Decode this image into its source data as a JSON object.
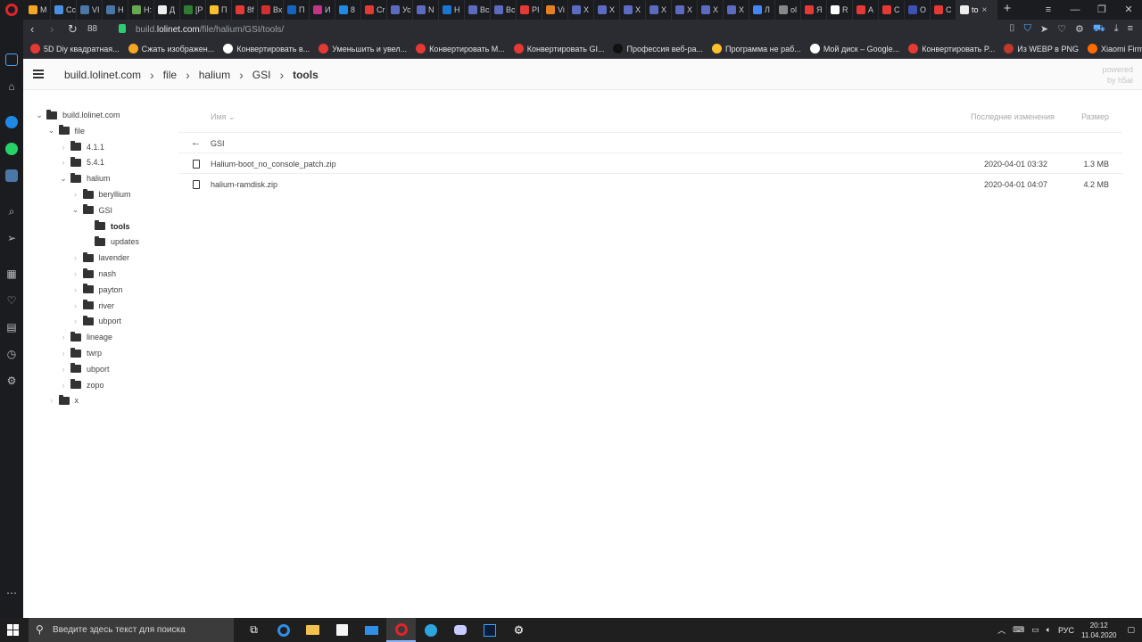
{
  "browser": {
    "tabs": [
      {
        "label": "M",
        "color": "#f5a623"
      },
      {
        "label": "Cc",
        "color": "#4a90e2"
      },
      {
        "label": "VI",
        "color": "#4a76a8"
      },
      {
        "label": "H",
        "color": "#4a76a8"
      },
      {
        "label": "H:",
        "color": "#6aa84f"
      },
      {
        "label": "Д",
        "color": "#eeeeee"
      },
      {
        "label": "[P",
        "color": "#2e7d32"
      },
      {
        "label": "П",
        "color": "#fbc02d"
      },
      {
        "label": "8f",
        "color": "#e53935"
      },
      {
        "label": "Вх",
        "color": "#d32f2f"
      },
      {
        "label": "П",
        "color": "#1565c0"
      },
      {
        "label": "И",
        "color": "#c13584"
      },
      {
        "label": "8",
        "color": "#1e88e5"
      },
      {
        "label": "Cr",
        "color": "#e53935"
      },
      {
        "label": "Ус",
        "color": "#5c6bc0"
      },
      {
        "label": "N",
        "color": "#5c6bc0"
      },
      {
        "label": "Н",
        "color": "#1976d2"
      },
      {
        "label": "Вс",
        "color": "#5c6bc0"
      },
      {
        "label": "Вс",
        "color": "#5c6bc0"
      },
      {
        "label": "PI",
        "color": "#e53935"
      },
      {
        "label": "Vi",
        "color": "#e67e22"
      },
      {
        "label": "X",
        "color": "#5c6bc0"
      },
      {
        "label": "X",
        "color": "#5c6bc0"
      },
      {
        "label": "X",
        "color": "#5c6bc0"
      },
      {
        "label": "X",
        "color": "#5c6bc0"
      },
      {
        "label": "X",
        "color": "#5c6bc0"
      },
      {
        "label": "X",
        "color": "#5c6bc0"
      },
      {
        "label": "X",
        "color": "#5c6bc0"
      },
      {
        "label": "Л",
        "color": "#4285f4"
      },
      {
        "label": "ol",
        "color": "#888888"
      },
      {
        "label": "Я",
        "color": "#e53935"
      },
      {
        "label": "R",
        "color": "#ffffff"
      },
      {
        "label": "A",
        "color": "#e53935"
      },
      {
        "label": "C",
        "color": "#e53935"
      },
      {
        "label": "O",
        "color": "#3f51b5"
      },
      {
        "label": "C",
        "color": "#e53935"
      }
    ],
    "active_tab": {
      "label": "to",
      "close": "×"
    },
    "new_tab": "+",
    "zoom": "88",
    "url_prefix": "build.",
    "url_domain": "lolinet.com",
    "url_path": "/file/halium/GSI/tools/",
    "bookmarks": [
      {
        "label": "5D Diy квадратная...",
        "color": "#e53935"
      },
      {
        "label": "Сжать изображен...",
        "color": "#f5a623"
      },
      {
        "label": "Конвертировать в...",
        "color": "#ffffff"
      },
      {
        "label": "Уменьшить и увел...",
        "color": "#e53935"
      },
      {
        "label": "Конвертировать М...",
        "color": "#e53935"
      },
      {
        "label": "Конвертировать GI...",
        "color": "#e53935"
      },
      {
        "label": "Профессия веб-ра...",
        "color": "#111111"
      },
      {
        "label": "Программа не раб...",
        "color": "#fbc02d"
      },
      {
        "label": "Мой диск – Google...",
        "color": "#ffffff"
      },
      {
        "label": "Конвертировать P...",
        "color": "#e53935"
      },
      {
        "label": "Из WEBP в PNG",
        "color": "#c0392b"
      },
      {
        "label": "Xiaomi Firmware U...",
        "color": "#ff6d00"
      }
    ]
  },
  "page": {
    "breadcrumbs": [
      "build.lolinet.com",
      "file",
      "halium",
      "GSI",
      "tools"
    ],
    "powered_line1": "powered",
    "powered_line2": "by h5ai",
    "tree": [
      {
        "label": "build.lolinet.com",
        "depth": 0,
        "open": true
      },
      {
        "label": "file",
        "depth": 1,
        "open": true
      },
      {
        "label": "4.1.1",
        "depth": 2,
        "open": false
      },
      {
        "label": "5.4.1",
        "depth": 2,
        "open": false
      },
      {
        "label": "halium",
        "depth": 2,
        "open": true
      },
      {
        "label": "beryllium",
        "depth": 3,
        "open": false
      },
      {
        "label": "GSI",
        "depth": 3,
        "open": true
      },
      {
        "label": "tools",
        "depth": 4,
        "open": null,
        "current": true
      },
      {
        "label": "updates",
        "depth": 4,
        "open": null
      },
      {
        "label": "lavender",
        "depth": 3,
        "open": false
      },
      {
        "label": "nash",
        "depth": 3,
        "open": false
      },
      {
        "label": "payton",
        "depth": 3,
        "open": false
      },
      {
        "label": "river",
        "depth": 3,
        "open": false
      },
      {
        "label": "ubport",
        "depth": 3,
        "open": false
      },
      {
        "label": "lineage",
        "depth": 2,
        "open": false
      },
      {
        "label": "twrp",
        "depth": 2,
        "open": false
      },
      {
        "label": "ubport",
        "depth": 2,
        "open": false
      },
      {
        "label": "zopo",
        "depth": 2,
        "open": false
      },
      {
        "label": "x",
        "depth": 1,
        "open": false
      }
    ],
    "list_header": {
      "name": "Имя",
      "modified": "Последние изменения",
      "size": "Размер"
    },
    "parent_row": {
      "name": "GSI"
    },
    "files": [
      {
        "name": "Halium-boot_no_console_patch.zip",
        "modified": "2020-04-01 03:32",
        "size": "1.3 MB"
      },
      {
        "name": "halium-ramdisk.zip",
        "modified": "2020-04-01 04:07",
        "size": "4.2 MB"
      }
    ]
  },
  "taskbar": {
    "search_placeholder": "Введите здесь текст для поиска",
    "lang": "РУС",
    "time": "20:12",
    "date": "11.04.2020"
  }
}
